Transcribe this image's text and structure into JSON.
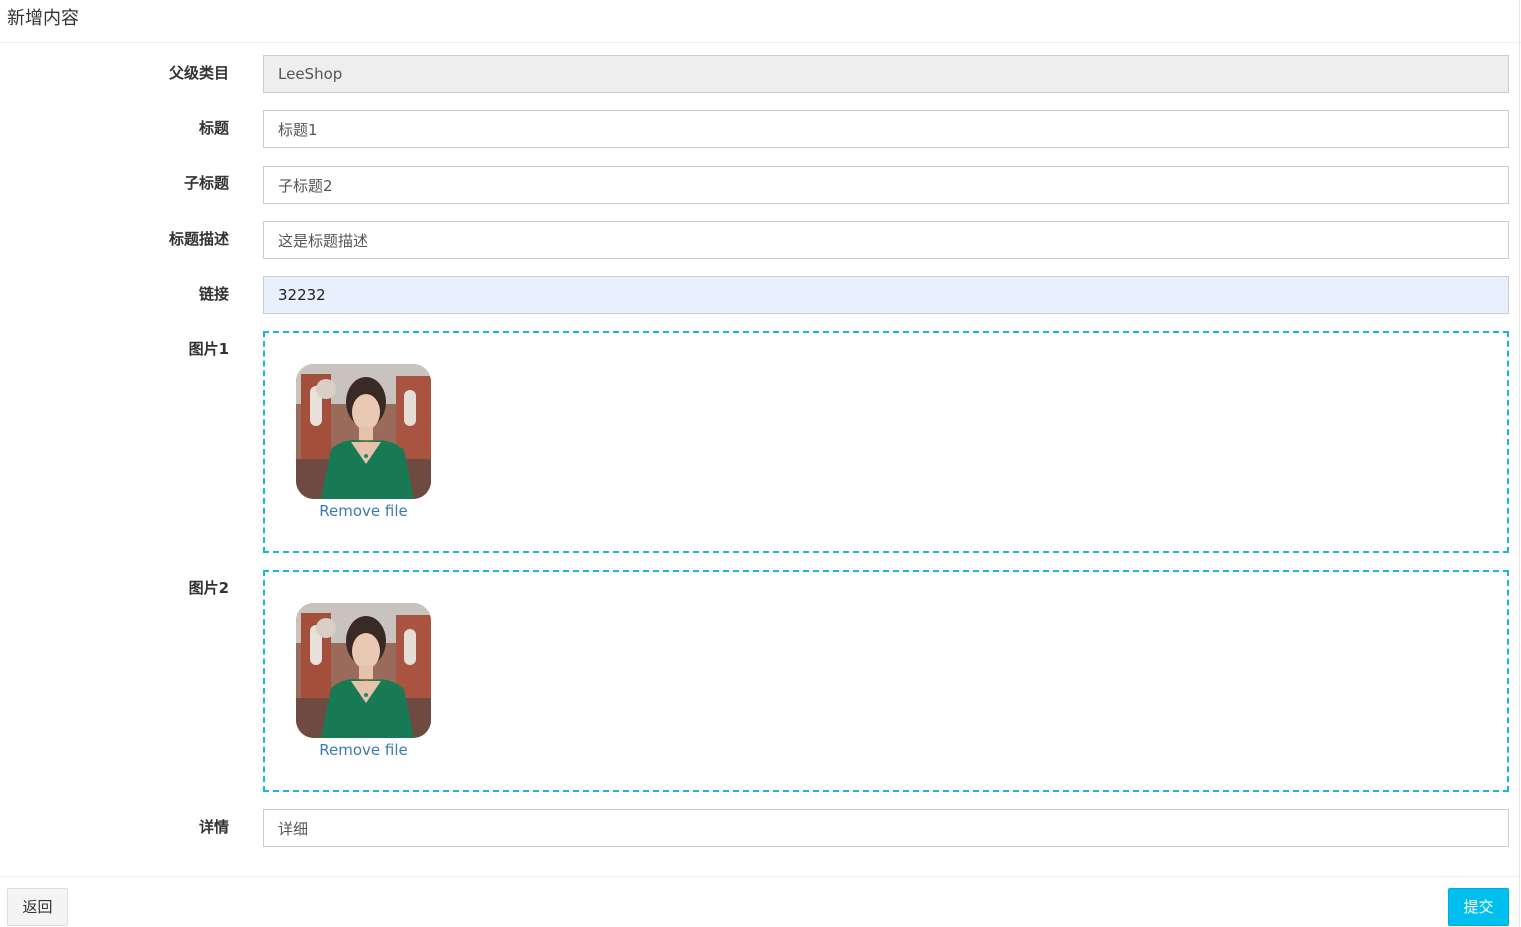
{
  "header": {
    "title": "新增内容"
  },
  "form": {
    "parent_category": {
      "label": "父级类目",
      "value": "LeeShop"
    },
    "title": {
      "label": "标题",
      "value": "标题1"
    },
    "subtitle": {
      "label": "子标题",
      "value": "子标题2"
    },
    "title_desc": {
      "label": "标题描述",
      "value": "这是标题描述"
    },
    "link": {
      "label": "链接",
      "value": "32232"
    },
    "image1": {
      "label": "图片1",
      "remove_label": "Remove file"
    },
    "image2": {
      "label": "图片2",
      "remove_label": "Remove file"
    },
    "detail": {
      "label": "详情",
      "value": "详细"
    }
  },
  "footer": {
    "back_label": "返回",
    "submit_label": "提交"
  },
  "colors": {
    "dropzone_border": "#1ab7d8",
    "submit_bg": "#00c0ef",
    "link": "#3b7ab5"
  }
}
